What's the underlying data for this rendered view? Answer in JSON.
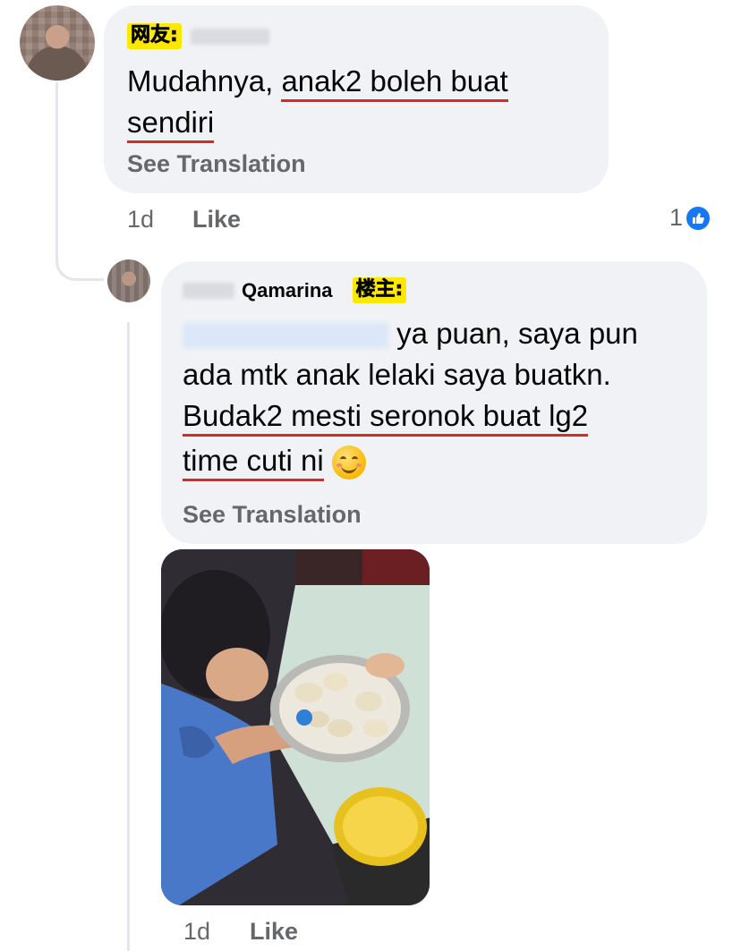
{
  "comment_1": {
    "tag": "网友:",
    "text_plain": "Mudahnya, ",
    "text_underlined_1": "anak2 boleh buat",
    "text_underlined_2": "sendiri",
    "see_translation": "See Translation",
    "time": "1d",
    "like_label": "Like",
    "like_count": "1"
  },
  "reply_1": {
    "author": "Qamarina",
    "tag": "楼主:",
    "text_line_1": "ya puan, saya pun",
    "text_line_2": "ada mtk anak lelaki saya buatkn.",
    "text_underlined_1": "Budak2 mesti seronok buat lg2",
    "text_underlined_2": "time cuti ni",
    "see_translation": "See Translation",
    "time": "1d",
    "like_label": "Like"
  },
  "colors": {
    "bubble_bg": "#f0f2f5",
    "meta_text": "#65676b",
    "underline": "#e0242b",
    "like_blue": "#1877f2",
    "tag_yellow": "#ffe800"
  },
  "icons": {
    "like_reaction": "thumbs-up-icon",
    "emoji": "smiling-face-icon"
  }
}
